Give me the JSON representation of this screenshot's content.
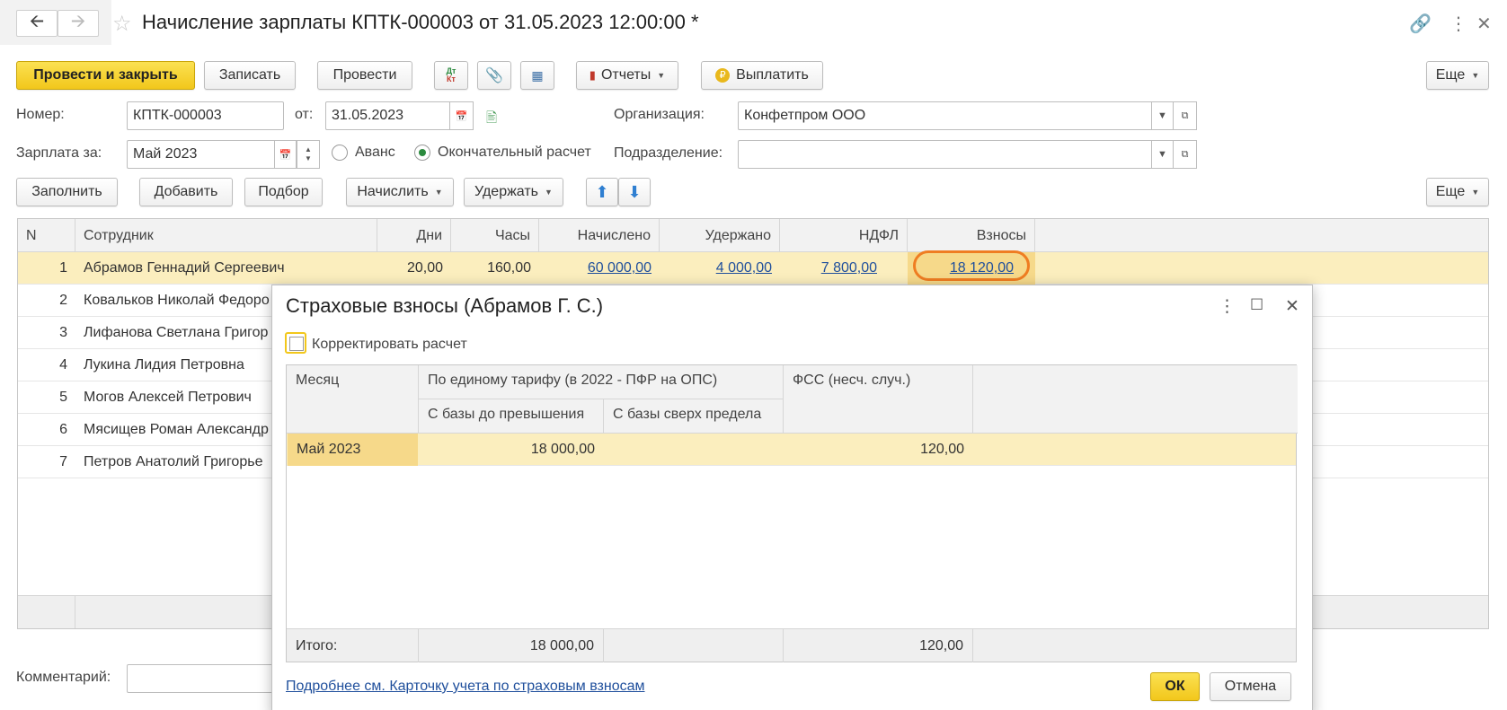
{
  "window": {
    "title": "Начисление зарплаты КПТК-000003 от 31.05.2023 12:00:00 *"
  },
  "toolbar": {
    "post_close": "Провести и закрыть",
    "save": "Записать",
    "post": "Провести",
    "reports": "Отчеты",
    "pay": "Выплатить",
    "more": "Еще",
    "dt_kt": "ДтКт"
  },
  "form": {
    "number_label": "Номер:",
    "number_value": "КПТК-000003",
    "date_label": "от:",
    "date_value": "31.05.2023",
    "org_label": "Организация:",
    "org_value": "Конфетпром ООО",
    "salary_for_label": "Зарплата за:",
    "salary_for_value": "Май 2023",
    "advance_label": "Аванс",
    "final_label": "Окончательный расчет",
    "dept_label": "Подразделение:",
    "dept_value": "",
    "comment_label": "Комментарий:"
  },
  "table_toolbar": {
    "fill": "Заполнить",
    "add": "Добавить",
    "pick": "Подбор",
    "accrue": "Начислить",
    "withhold": "Удержать",
    "more": "Еще"
  },
  "table": {
    "columns": [
      "N",
      "Сотрудник",
      "Дни",
      "Часы",
      "Начислено",
      "Удержано",
      "НДФЛ",
      "Взносы"
    ],
    "rows": [
      {
        "n": "1",
        "name": "Абрамов Геннадий Сергеевич",
        "days": "20,00",
        "hours": "160,00",
        "accrued": "60 000,00",
        "withheld": "4 000,00",
        "ndfl": "7 800,00",
        "contrib": "18 120,00"
      },
      {
        "n": "2",
        "name": "Ковальков Николай Федоро"
      },
      {
        "n": "3",
        "name": "Лифанова Светлана Григор"
      },
      {
        "n": "4",
        "name": "Лукина Лидия Петровна"
      },
      {
        "n": "5",
        "name": "Могов Алексей Петрович"
      },
      {
        "n": "6",
        "name": "Мясищев Роман Александр"
      },
      {
        "n": "7",
        "name": "Петров Анатолий Григорье"
      }
    ]
  },
  "dialog": {
    "title": "Страховые взносы (Абрамов Г. С.)",
    "correct_label": "Корректировать расчет",
    "col_month": "Месяц",
    "col_single_tariff": "По единому тарифу (в 2022 - ПФР на ОПС)",
    "col_base_below": "С базы до превышения",
    "col_base_above": "С базы сверх предела",
    "col_fss": "ФСС (несч. случ.)",
    "row": {
      "month": "Май 2023",
      "below": "18 000,00",
      "above": "",
      "fss": "120,00"
    },
    "total_label": "Итого:",
    "total_below": "18 000,00",
    "total_fss": "120,00",
    "link": "Подробнее см. Карточку учета по страховым взносам",
    "ok": "ОК",
    "cancel": "Отмена"
  },
  "colors": {
    "accent_yellow": "#f2c71b",
    "selected_row": "#fbeebe",
    "link": "#1f4f9c",
    "highlight_ring": "#ef7d22"
  }
}
